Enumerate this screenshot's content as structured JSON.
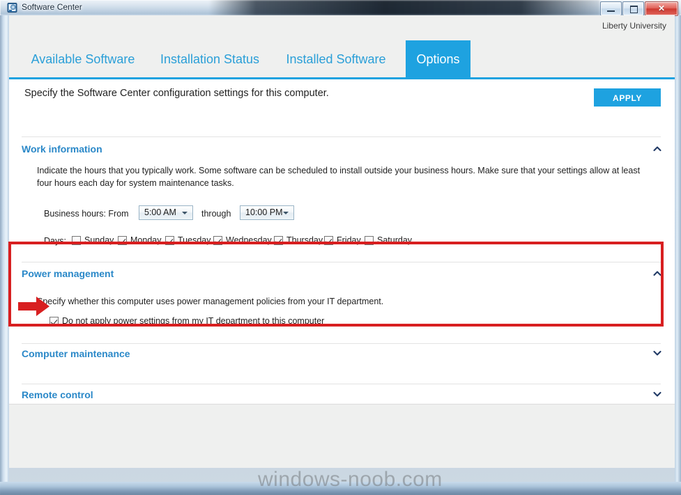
{
  "window": {
    "title": "Software Center",
    "icon": "software-center-icon",
    "controls": {
      "minimize": "minimize-button",
      "maximize": "maximize-button",
      "close_label": "✕"
    }
  },
  "header": {
    "organization": "Liberty University"
  },
  "tabs": [
    {
      "label": "Available Software",
      "active": false
    },
    {
      "label": "Installation Status",
      "active": false
    },
    {
      "label": "Installed Software",
      "active": false
    },
    {
      "label": "Options",
      "active": true
    }
  ],
  "intro": "Specify the Software Center configuration settings for this computer.",
  "sections": [
    {
      "id": "work-information",
      "title": "Work information",
      "expanded": true,
      "chevron": "chevron-up-icon",
      "description": "Indicate the hours that you typically work. Some software can be scheduled to install outside your business hours. Make sure that your settings allow at least four hours each day for system maintenance tasks.",
      "business_hours": {
        "prefix_label": "Business hours: From",
        "from_value": "5:00 AM",
        "middle_label": "through",
        "to_value": "10:00 PM"
      },
      "days": {
        "label": "Days:",
        "items": [
          {
            "name": "Sunday",
            "checked": false
          },
          {
            "name": "Monday",
            "checked": true
          },
          {
            "name": "Tuesday",
            "checked": true
          },
          {
            "name": "Wednesday",
            "checked": true
          },
          {
            "name": "Thursday",
            "checked": true
          },
          {
            "name": "Friday",
            "checked": true
          },
          {
            "name": "Saturday",
            "checked": false
          }
        ]
      }
    },
    {
      "id": "power-management",
      "title": "Power management",
      "expanded": true,
      "chevron": "chevron-up-icon",
      "description": "Specify whether this computer uses power management policies from your IT department.",
      "checkbox": {
        "label": "Do not apply power settings from my IT department to this computer",
        "checked": true
      },
      "highlight_color": "#d81f20"
    },
    {
      "id": "computer-maintenance",
      "title": "Computer maintenance",
      "expanded": false,
      "chevron": "chevron-down-icon"
    },
    {
      "id": "remote-control",
      "title": "Remote control",
      "expanded": false,
      "chevron": "chevron-down-icon"
    }
  ],
  "footer": {
    "apply_label": "APPLY"
  },
  "watermark": "windows-noob.com",
  "colors": {
    "accent": "#1ea2e0",
    "section_title": "#2a88c8",
    "tab_inactive": "#2a9fd8",
    "annotation_red": "#d81f20",
    "app_chrome": "#eff0ef"
  }
}
